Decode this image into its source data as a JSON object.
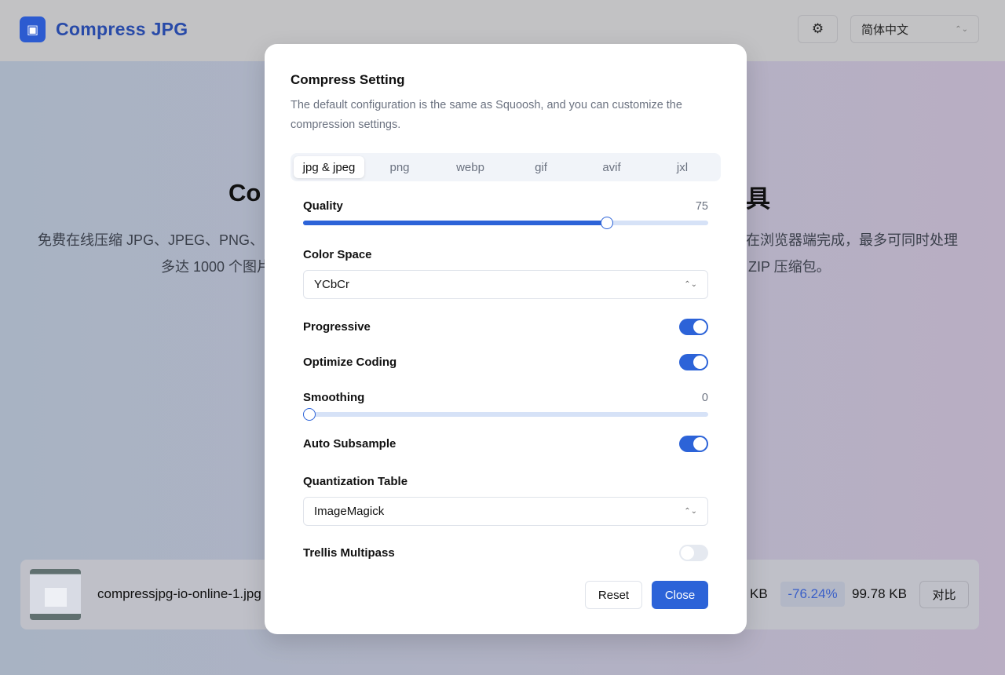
{
  "header": {
    "brand": "Compress JPG",
    "logo_icon": "image-compress-icon",
    "settings_icon": "gear-icon",
    "language": "简体中文"
  },
  "background": {
    "title_left": "Co",
    "title_right": "具",
    "desc_line1_left": "免费在线压缩 JPG、JPEG、PNG、",
    "desc_line1_right": "在浏览器端完成，最多可同时处理",
    "desc_line2_left": "多达 1000 个图片",
    "desc_line2_right": "的 ZIP 压缩包。"
  },
  "file": {
    "name": "compressjpg-io-online-1.jpg",
    "original_size_suffix": "KB",
    "reduction": "-76.24%",
    "compressed_size": "99.78 KB",
    "compare_label": "对比"
  },
  "modal": {
    "title": "Compress Setting",
    "description": "The default configuration is the same as Squoosh, and you can customize the compression settings.",
    "tabs": [
      {
        "label": "jpg & jpeg",
        "active": true
      },
      {
        "label": "png"
      },
      {
        "label": "webp"
      },
      {
        "label": "gif"
      },
      {
        "label": "avif"
      },
      {
        "label": "jxl"
      }
    ],
    "quality": {
      "label": "Quality",
      "value": "75",
      "min": 0,
      "max": 100
    },
    "color_space": {
      "label": "Color Space",
      "value": "YCbCr"
    },
    "progressive": {
      "label": "Progressive",
      "on": true
    },
    "optimize_coding": {
      "label": "Optimize Coding",
      "on": true
    },
    "smoothing": {
      "label": "Smoothing",
      "value": "0",
      "min": 0,
      "max": 100
    },
    "auto_subsample": {
      "label": "Auto Subsample",
      "on": true
    },
    "quantization_table": {
      "label": "Quantization Table",
      "value": "ImageMagick"
    },
    "trellis_multipass": {
      "label": "Trellis Multipass",
      "on": false
    },
    "reset_label": "Reset",
    "close_label": "Close"
  },
  "colors": {
    "accent": "#2c63d8",
    "brand": "#284aa8"
  }
}
